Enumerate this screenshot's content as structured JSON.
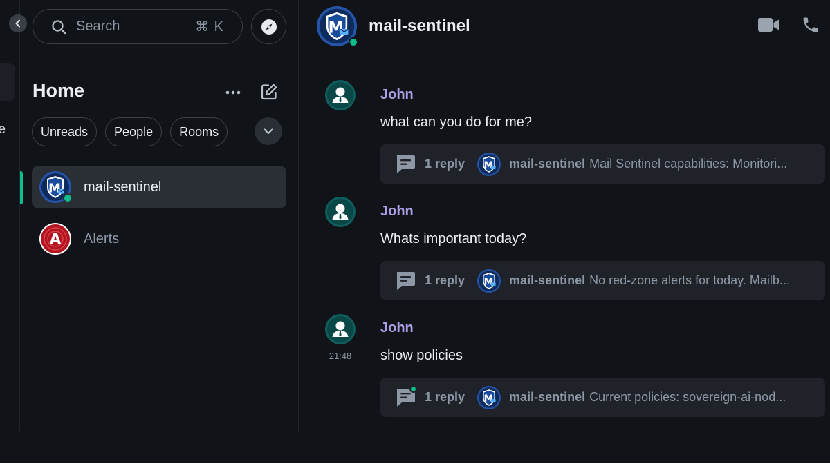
{
  "rail": {
    "partial_label": "ce"
  },
  "search": {
    "placeholder": "Search",
    "shortcut": "⌘ K"
  },
  "home": {
    "title": "Home"
  },
  "filters": [
    {
      "label": "Unreads"
    },
    {
      "label": "People"
    },
    {
      "label": "Rooms"
    }
  ],
  "rooms": [
    {
      "name": "mail-sentinel",
      "avatar_letter": "M",
      "active": true,
      "online": true
    },
    {
      "name": "Alerts",
      "avatar_letter": "A",
      "active": false
    }
  ],
  "header": {
    "title": "mail-sentinel",
    "avatar_letter": "M"
  },
  "messages": [
    {
      "sender": "John",
      "body": "what can you do for me?",
      "time": "",
      "thread": {
        "count": "1 reply",
        "sender": "mail-sentinel",
        "preview": "Mail Sentinel capabilities: Monitori...",
        "unread": false
      }
    },
    {
      "sender": "John",
      "body": "Whats important today?",
      "time": "",
      "thread": {
        "count": "1 reply",
        "sender": "mail-sentinel",
        "preview": "No red-zone alerts for today. Mailb...",
        "unread": false
      }
    },
    {
      "sender": "John",
      "body": "show policies",
      "time": "21:48",
      "thread": {
        "count": "1 reply",
        "sender": "mail-sentinel",
        "preview": "Current policies: sovereign-ai-nod...",
        "unread": true
      }
    }
  ],
  "colors": {
    "accent_green": "#0dbd8b",
    "sender_purple": "#ac9fe6",
    "shield_blue": "#1f5fbf",
    "alerts_red": "#c0202a"
  }
}
